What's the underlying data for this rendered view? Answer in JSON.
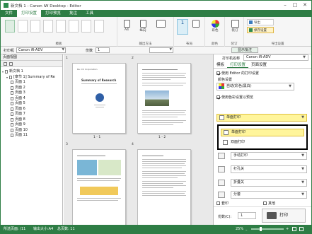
{
  "window": {
    "title": "新文档 1 - Canon iW Desktop - Editor",
    "accent_color": "#2e7d45"
  },
  "menu_tabs": [
    "文件",
    "打印设置",
    "打印预览",
    "批注",
    "工具"
  ],
  "ribbon": {
    "groups": [
      {
        "label": "模板"
      },
      {
        "label": "输出方法"
      },
      {
        "label": "布局"
      },
      {
        "label": "颜色"
      },
      {
        "label": "装订"
      },
      {
        "label": "导出设置"
      }
    ],
    "buttons": {
      "size": "A4",
      "orientation": "纵向",
      "pages_per_sheet": "1",
      "color_mode": "彩色",
      "binding": "装订",
      "import": "导出",
      "save_settings": "保存设置"
    }
  },
  "print_bar": {
    "printer_label": "打印机",
    "printer_value": "Canon iR-ADV",
    "copies_label": "份数",
    "copies_value": "1",
    "show_settings": "显示批注"
  },
  "left_panel": {
    "header": "页面视图",
    "tree": [
      {
        "label": "新文档 1",
        "level": 0
      },
      {
        "label": "[章节 1] Summary of Re",
        "level": 1
      },
      {
        "label": "页面 1",
        "level": 2
      },
      {
        "label": "页面 2",
        "level": 2
      },
      {
        "label": "页面 3",
        "level": 2
      },
      {
        "label": "页面 4",
        "level": 2
      },
      {
        "label": "页面 5",
        "level": 2
      },
      {
        "label": "页面 6",
        "level": 2
      },
      {
        "label": "页面 7",
        "level": 2
      },
      {
        "label": "页面 8",
        "level": 2
      },
      {
        "label": "页面 9",
        "level": 2
      },
      {
        "label": "页面 10",
        "level": 2
      },
      {
        "label": "页面 11",
        "level": 2
      }
    ]
  },
  "main_area": {
    "sheets": [
      {
        "number": "1",
        "pages": "1 - 1"
      },
      {
        "number": "2",
        "pages": "1 - 2"
      },
      {
        "number": "3",
        "pages": ""
      },
      {
        "number": "4",
        "pages": ""
      }
    ],
    "page1_heading": "Summary of Research",
    "page1_company": "Re: XX Corporation"
  },
  "right_panel": {
    "printer_field_label": "打印机名称",
    "printer_field_value": "Canon iR-ADV",
    "tabs": [
      "模板",
      "打印设置",
      "页面设置"
    ],
    "use_editor_label": "使用 Editor 的打印设置",
    "color_label": "颜色设置",
    "color_value": "自动(彩色/黑白)",
    "apply_color_label": "使用色彩设置以预览",
    "duplex_value": "单面打印",
    "dropdown_options": [
      "单面打印",
      "双面打印"
    ],
    "staple_value": "手动打印",
    "punch_value": "打孔关",
    "fold_value": "折叠关",
    "sort_value": "分套",
    "collate_label": "套印",
    "other_label": "其他",
    "copies_label": "份数(C):",
    "copies_value": "1",
    "print_button": "打印"
  },
  "status_bar": {
    "page_info": "所选页面: /11",
    "paper_info": "输出大小:A4",
    "sheets_info": "总页数: 11",
    "zoom": "25%"
  }
}
